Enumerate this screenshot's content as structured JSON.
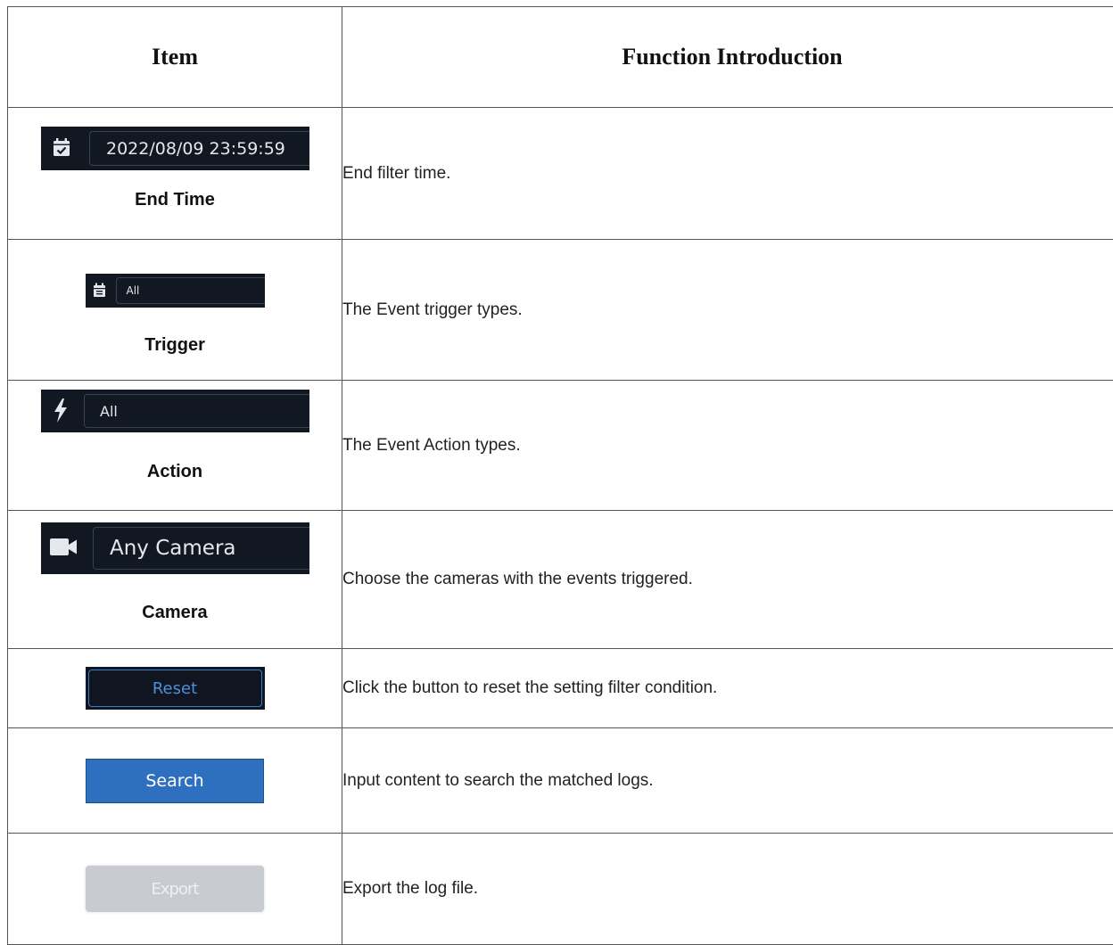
{
  "header": {
    "item": "Item",
    "function": "Function Introduction"
  },
  "rows": [
    {
      "name": "End Time",
      "widget_value": "2022/08/09 23:59:59",
      "widget_icon": "calendar-check-icon",
      "description": "End filter time."
    },
    {
      "name": "Trigger",
      "widget_value": "All",
      "widget_icon": "calendar-icon",
      "description": "The Event trigger types."
    },
    {
      "name": "Action",
      "widget_value": "All",
      "widget_icon": "lightning-icon",
      "description": "The Event Action types."
    },
    {
      "name": "Camera",
      "widget_value": "Any Camera",
      "widget_icon": "video-camera-icon",
      "description": "Choose the cameras with the events triggered."
    },
    {
      "button_label": "Reset",
      "description": "Click the button to reset the setting filter condition."
    },
    {
      "button_label": "Search",
      "description": "Input content to search the matched logs."
    },
    {
      "button_label": "Export",
      "description": "Export the log file."
    }
  ],
  "colors": {
    "widget_bg": "#121822",
    "reset_border": "#2f7fd6",
    "reset_text": "#4d8fdb",
    "search_bg": "#2f6fbf",
    "export_bg": "#c8ccd2",
    "border": "#555555"
  }
}
